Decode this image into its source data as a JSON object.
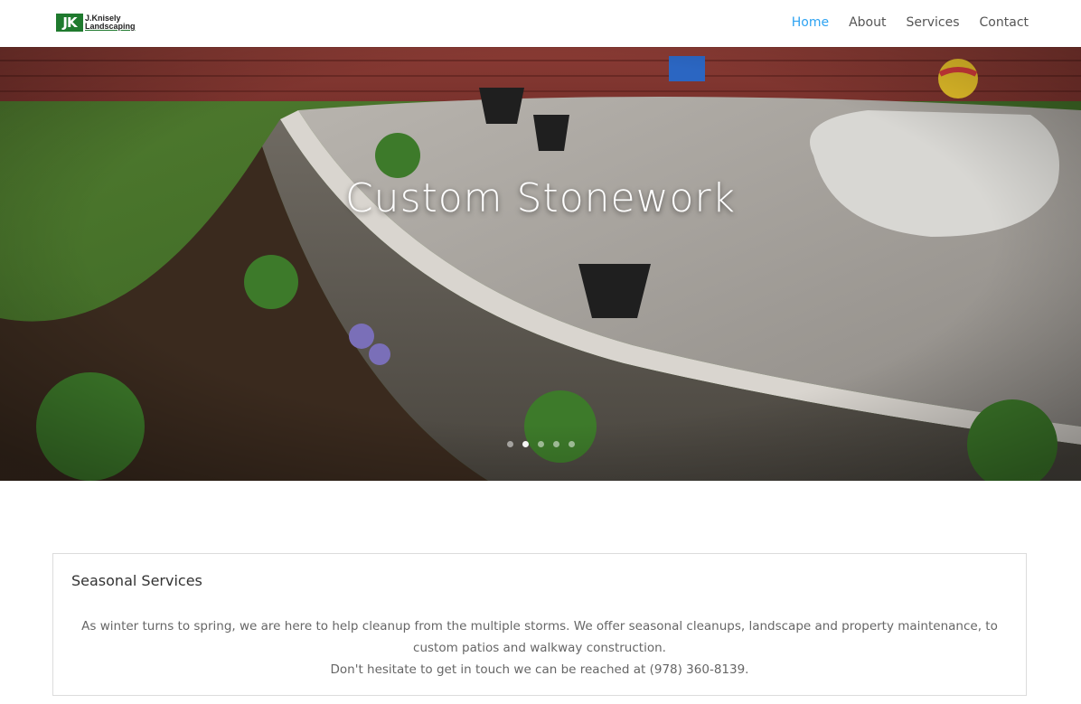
{
  "logo": {
    "mark": "JK",
    "line1": "J.Knisely",
    "line2": "Landscaping"
  },
  "nav": {
    "items": [
      {
        "label": "Home",
        "active": true
      },
      {
        "label": "About",
        "active": false
      },
      {
        "label": "Services",
        "active": false
      },
      {
        "label": "Contact",
        "active": false
      }
    ]
  },
  "hero": {
    "title": "Custom Stonework",
    "slides_count": 5,
    "active_slide": 2
  },
  "card": {
    "title": "Seasonal Services",
    "paragraph1": "As winter turns to spring, we are here to help cleanup from the multiple storms. We offer seasonal cleanups, landscape and property maintenance, to custom patios and walkway construction.",
    "paragraph2": "Don't hesitate to get in touch we can be reached at (978) 360-8139."
  },
  "colors": {
    "accent": "#2ea3f2",
    "logo_green": "#1f7a2e",
    "nav_text": "#555555"
  }
}
